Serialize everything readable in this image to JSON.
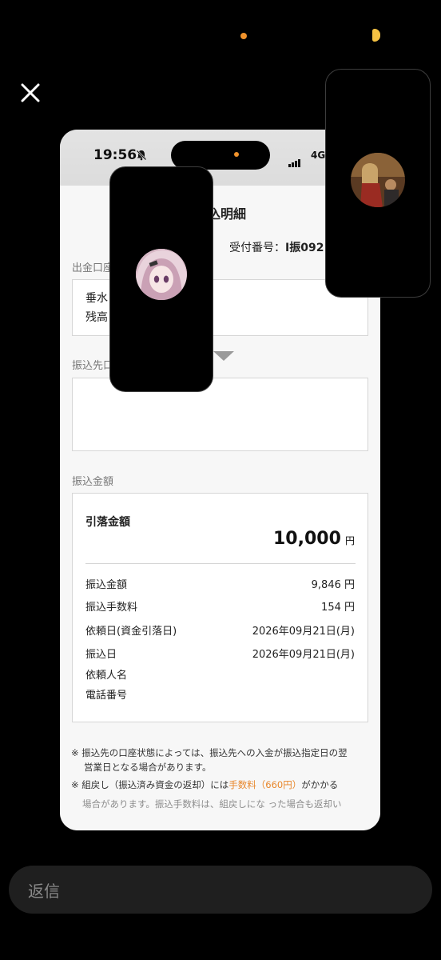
{
  "status": {
    "time": "19:56",
    "network": "4G"
  },
  "page": {
    "title": "込明細",
    "receipt_label": "受付番号：",
    "receipt_number": "I振0921"
  },
  "from_account": {
    "label": "出金口座",
    "line1": "垂水",
    "line2": "残高"
  },
  "to_account": {
    "label": "振込先口"
  },
  "amount_section": {
    "label": "振込金額",
    "withdrawal_label": "引落金額",
    "withdrawal_value": "10,000",
    "yen": "円",
    "rows": [
      {
        "label": "振込金額",
        "value": "9,846 円"
      },
      {
        "label": "振込手数料",
        "value": "154 円"
      },
      {
        "label": "依頼日(資金引落日)",
        "value": "2026年09月21日(月)"
      },
      {
        "label": "振込日",
        "value": "2026年09月21日(月)"
      },
      {
        "label": "依頼人名",
        "value": ""
      },
      {
        "label": "電話番号",
        "value": ""
      }
    ]
  },
  "notes": {
    "mark": "※",
    "note1_line1": "振込先の口座状態によっては、振込先への入金が振込指定日の翌",
    "note1_line2": "営業日となる場合があります。",
    "note2_prefix": "組戻し（振込済み資金の返却）には",
    "note2_highlight": "手数料（660円）",
    "note2_suffix": "がかかる",
    "note2_line2": "場合があります。振込手数料は、組戻しにな った場合も返却い"
  },
  "reply": {
    "placeholder": "返信"
  },
  "icons": {
    "close": "close-icon",
    "bell": "bell-slash-icon",
    "signal": "signal-bars-icon"
  },
  "colors": {
    "accent": "#e8862a",
    "background": "#000000"
  }
}
